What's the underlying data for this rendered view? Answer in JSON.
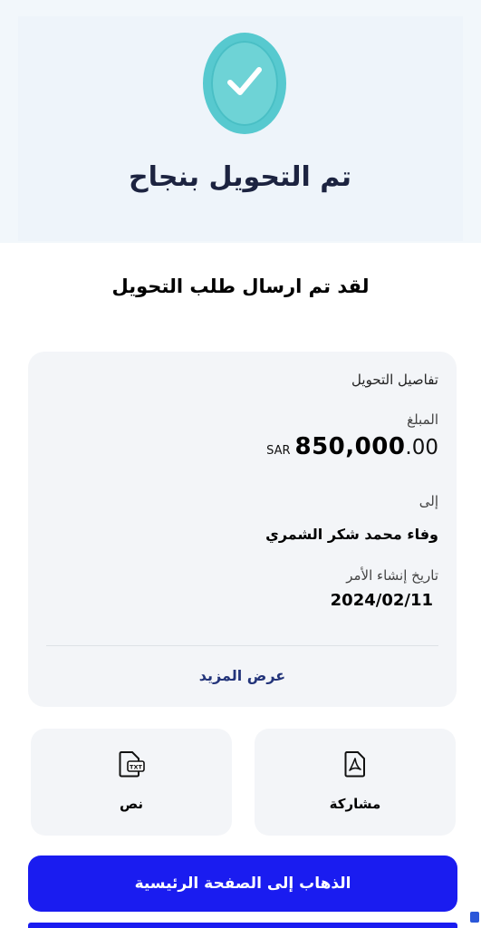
{
  "hero": {
    "title": "تم التحويل بنجاح",
    "icon": "check-circle-icon",
    "accent_color": "#6ed3d6"
  },
  "headline": "لقد تم ارسال طلب التحويل",
  "details": {
    "section_title": "تفاصيل التحويل",
    "amount_label": "المبلغ",
    "amount_currency": "SAR",
    "amount_integer": "850,000",
    "amount_decimal": ".00",
    "to_label": "إلى",
    "recipient_name": "وفاء محمد شكر الشمري",
    "date_label": "تاريخ إنشاء الأمر",
    "date_value": "2024/02/11",
    "more_link": "عرض المزيد"
  },
  "actions": {
    "share_label": "مشاركة",
    "share_icon": "pdf-icon",
    "text_label": "نص",
    "text_icon": "txt-file-icon"
  },
  "home_button": {
    "label": "الذهاب إلى الصفحة الرئيسية",
    "color": "#1a1cf0"
  }
}
